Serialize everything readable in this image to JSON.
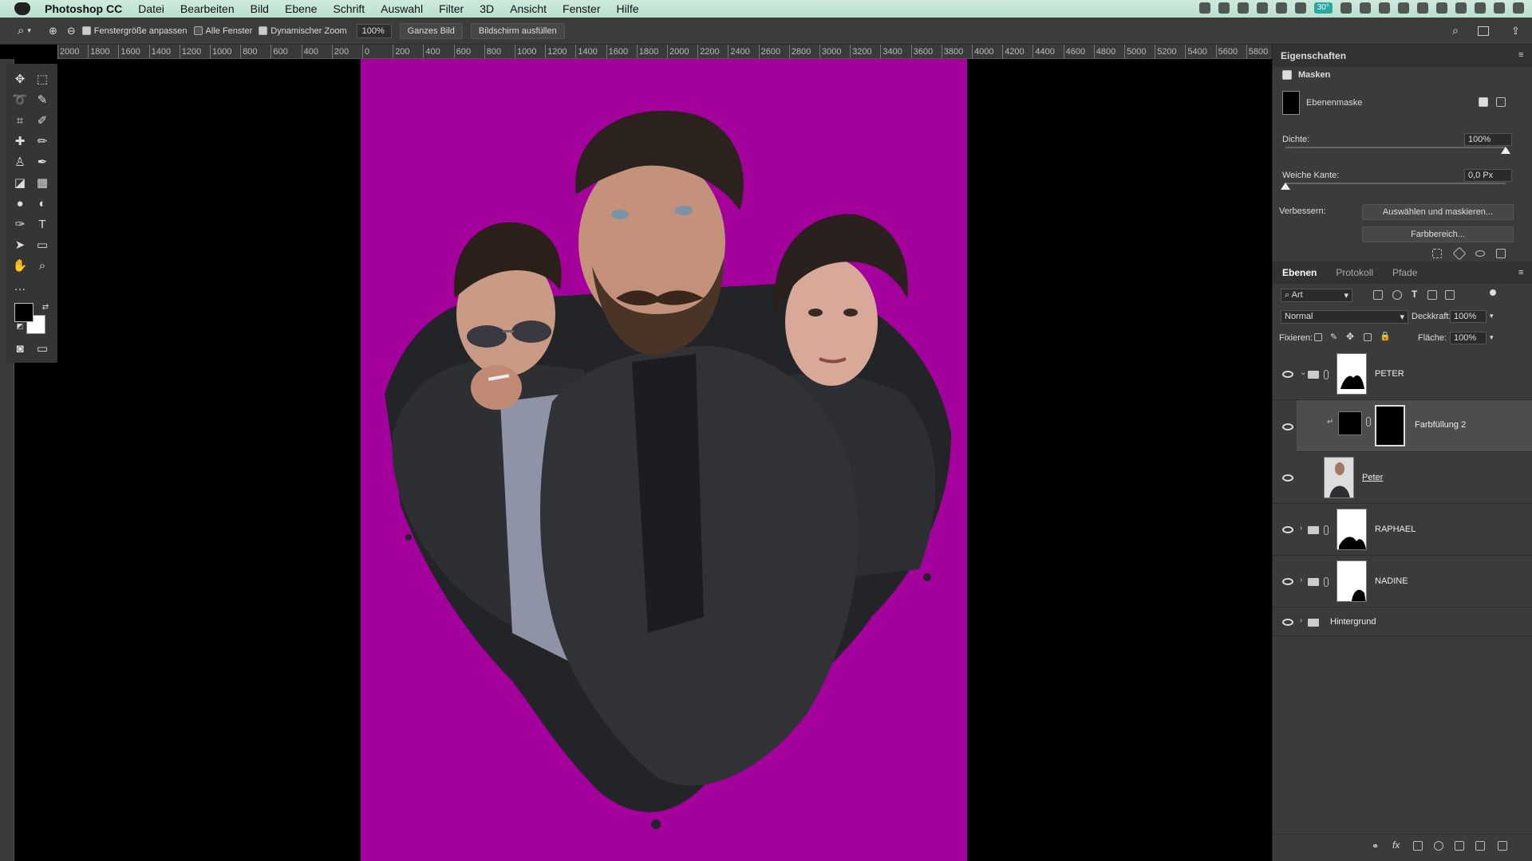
{
  "menubar": {
    "app": "Photoshop CC",
    "items": [
      "Datei",
      "Bearbeiten",
      "Bild",
      "Ebene",
      "Schrift",
      "Auswahl",
      "Filter",
      "3D",
      "Ansicht",
      "Fenster",
      "Hilfe"
    ],
    "status_badge": "30°"
  },
  "options": {
    "fenstergroesse": "Fenstergröße anpassen",
    "alle_fenster": "Alle Fenster",
    "dyn_zoom": "Dynamischer Zoom",
    "zoom": "100%",
    "ganzes_bild": "Ganzes Bild",
    "bildschirm": "Bildschirm ausfüllen"
  },
  "ruler": [
    "2000",
    "1800",
    "1600",
    "1400",
    "1200",
    "1000",
    "800",
    "600",
    "400",
    "200",
    "0",
    "200",
    "400",
    "600",
    "800",
    "1000",
    "1200",
    "1400",
    "1600",
    "1800",
    "2000",
    "2200",
    "2400",
    "2600",
    "2800",
    "3000",
    "3200",
    "3400",
    "3600",
    "3800",
    "4000",
    "4200",
    "4400",
    "4600",
    "4800",
    "5000",
    "5200",
    "5400",
    "5600",
    "5800"
  ],
  "properties": {
    "title": "Eigenschaften",
    "section": "Masken",
    "mask_label": "Ebenenmaske",
    "dichte_label": "Dichte:",
    "dichte_value": "100%",
    "dichte_level": 1.0,
    "kante_label": "Weiche Kante:",
    "kante_value": "0,0 Px",
    "kante_level": 0.0,
    "verbessern_label": "Verbessern:",
    "btn_auswaehlen": "Auswählen und maskieren...",
    "btn_farbbereich": "Farbbereich..."
  },
  "layers_panel": {
    "tabs": [
      "Ebenen",
      "Protokoll",
      "Pfade"
    ],
    "filter": "Art",
    "blend_mode": "Normal",
    "deckkraft_label": "Deckkraft:",
    "deckkraft_value": "100%",
    "fixieren_label": "Fixieren:",
    "flaeche_label": "Fläche:",
    "flaeche_value": "100%",
    "layers": [
      {
        "name": "PETER",
        "type": "group"
      },
      {
        "name": "Farbfüllung 2",
        "type": "fill"
      },
      {
        "name": "Peter",
        "type": "smart"
      },
      {
        "name": "RAPHAEL",
        "type": "group"
      },
      {
        "name": "NADINE",
        "type": "group"
      },
      {
        "name": "Hintergrund",
        "type": "group"
      }
    ]
  },
  "colors": {
    "canvas_bg": "#a4009b",
    "panel_bg": "#3b3b3b"
  }
}
